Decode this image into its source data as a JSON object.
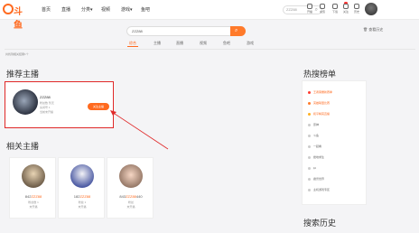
{
  "header": {
    "logo_text": "斗鱼",
    "nav": [
      {
        "label": "首页"
      },
      {
        "label": "直播"
      },
      {
        "label": "分类▾"
      },
      {
        "label": "视频"
      },
      {
        "label": "游戏▾"
      },
      {
        "label": "鱼吧"
      }
    ],
    "search_value": "ZZZ88",
    "icons": [
      {
        "name": "live-icon",
        "label": "开播"
      },
      {
        "name": "recharge-icon",
        "label": "充值"
      },
      {
        "name": "message-icon",
        "label": "下载"
      },
      {
        "name": "download-icon",
        "label": "关注"
      },
      {
        "name": "follow-icon",
        "label": "历史"
      }
    ]
  },
  "results": {
    "search_value": "ZZZ88",
    "history_link": "查看历史",
    "tabs": [
      {
        "label": "综合"
      },
      {
        "label": "主播"
      },
      {
        "label": "直播"
      },
      {
        "label": "视频"
      },
      {
        "label": "鱼吧"
      },
      {
        "label": "游戏"
      }
    ],
    "summary": "共找到相关结果1个"
  },
  "recommended": {
    "title": "推荐主播",
    "streamer": {
      "name": "ZZZ88",
      "lines": [
        "粉丝数 暂无",
        "房间号 1",
        "当前未开播"
      ],
      "follow_label": "关注主播"
    }
  },
  "related": {
    "title": "相关主播",
    "cards": [
      {
        "prefix": "842",
        "highlight": "ZZZ88",
        "suffix": "",
        "line1": "粉丝数 1",
        "line2": "未开播"
      },
      {
        "prefix": "182",
        "highlight": "ZZZ88",
        "suffix": "",
        "line1": "粉丝 1",
        "line2": "未开播"
      },
      {
        "prefix": "843",
        "highlight": "ZZZ88",
        "suffix": "440",
        "line1": "粉丝",
        "line2": "未开播"
      }
    ]
  },
  "hot_list": {
    "title": "热搜榜单",
    "items": [
      "王者荣耀新赛季",
      "英雄联盟比赛",
      "和平精英直播",
      "原神",
      "斗鱼",
      "一起看",
      "绝地求生",
      "lpl",
      "魔兽世界",
      "主机游戏专区"
    ]
  },
  "history": {
    "title": "搜索历史"
  },
  "colors": {
    "accent": "#ff6a1f",
    "highlight_border": "#e02828"
  }
}
